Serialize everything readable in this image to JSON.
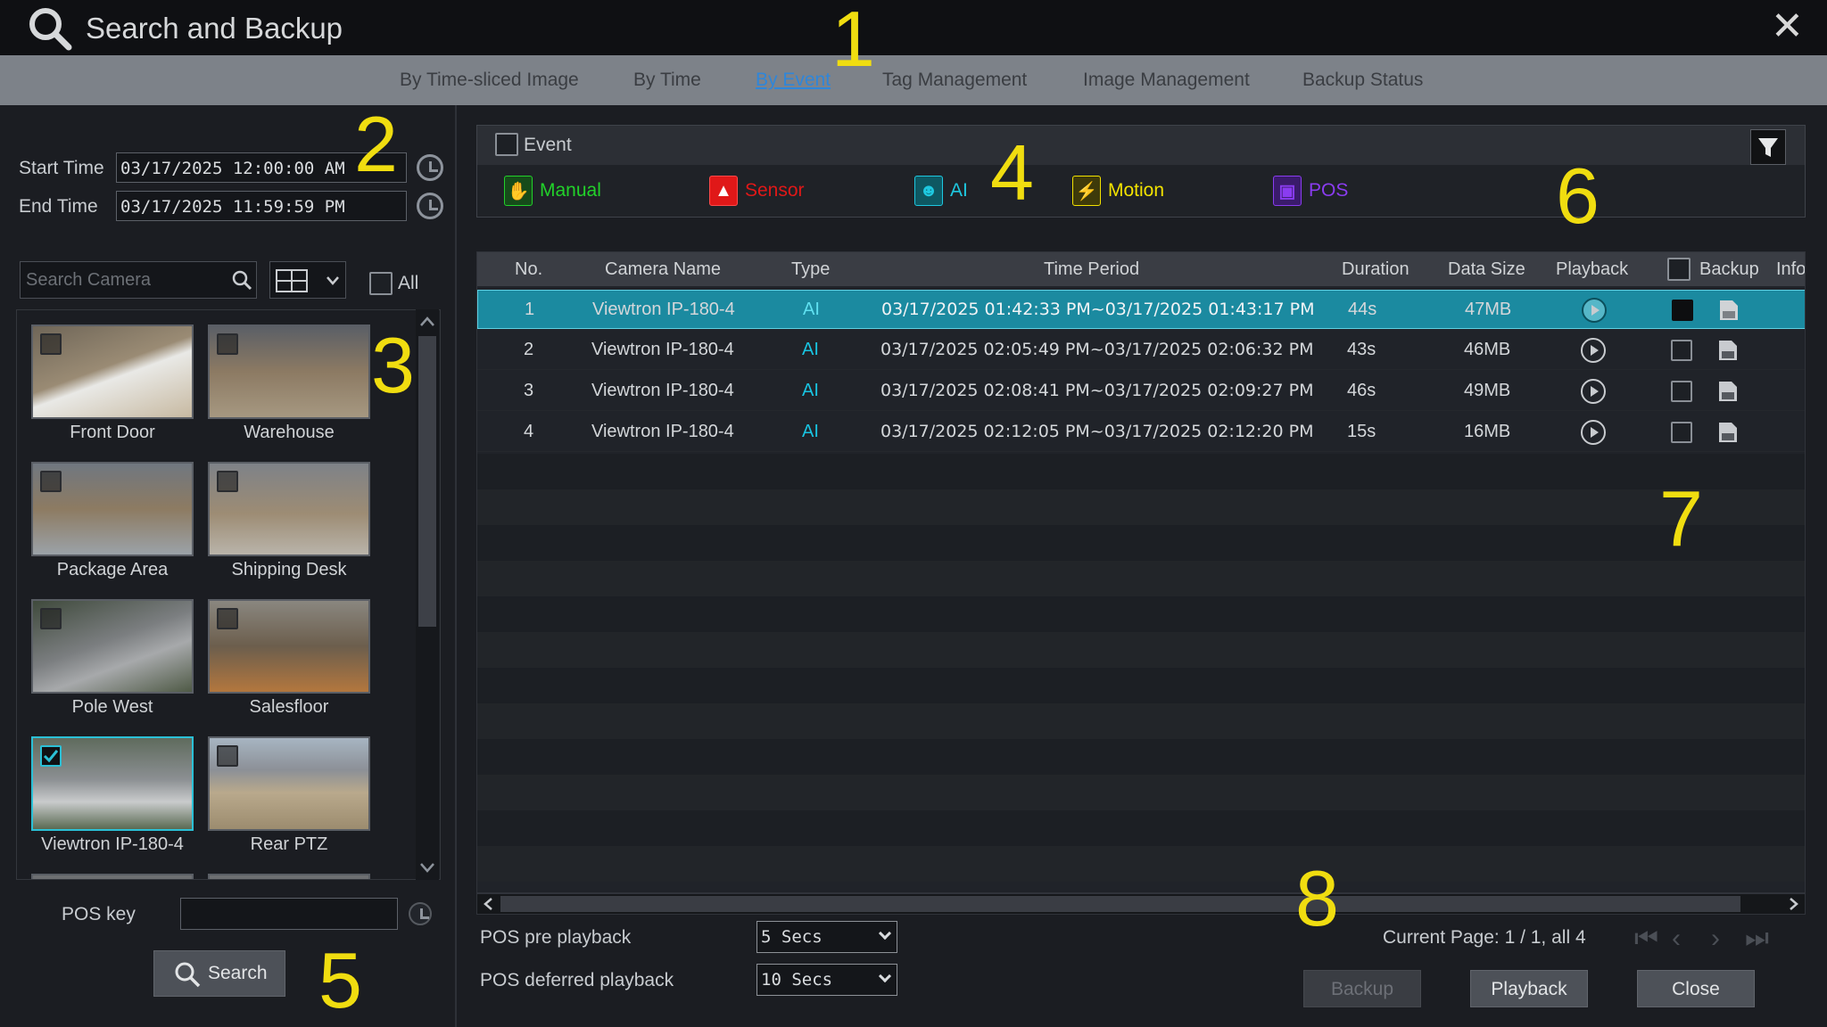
{
  "window": {
    "title": "Search and Backup",
    "close_glyph": "✕"
  },
  "tabs": [
    {
      "label": "By Time-sliced Image"
    },
    {
      "label": "By Time"
    },
    {
      "label": "By Event",
      "active": true
    },
    {
      "label": "Tag Management"
    },
    {
      "label": "Image Management"
    },
    {
      "label": "Backup Status"
    }
  ],
  "left": {
    "start_label": "Start Time",
    "start_value": "03/17/2025 12:00:00 AM",
    "end_label": "End Time",
    "end_value": "03/17/2025 11:59:59 PM",
    "search_placeholder": "Search Camera",
    "all_label": "All",
    "cameras": [
      {
        "name": "Front Door",
        "selected": false
      },
      {
        "name": "Warehouse",
        "selected": false
      },
      {
        "name": "Package Area",
        "selected": false
      },
      {
        "name": "Shipping Desk",
        "selected": false
      },
      {
        "name": "Pole West",
        "selected": false
      },
      {
        "name": "Salesfloor",
        "selected": false
      },
      {
        "name": "Viewtron IP-180-4",
        "selected": true
      },
      {
        "name": "Rear PTZ",
        "selected": false
      }
    ],
    "pos_key_label": "POS key",
    "search_button": "Search"
  },
  "events": {
    "header_label": "Event",
    "items": [
      {
        "label": "Manual",
        "color": "#22d12a"
      },
      {
        "label": "Sensor",
        "color": "#e01818"
      },
      {
        "label": "AI",
        "color": "#1ec8e0"
      },
      {
        "label": "Motion",
        "color": "#f2e200"
      },
      {
        "label": "POS",
        "color": "#8a3cf0"
      }
    ]
  },
  "table": {
    "headers": [
      "No.",
      "Camera Name",
      "Type",
      "Time Period",
      "Duration",
      "Data Size",
      "Playback",
      "Backup",
      "Info"
    ],
    "rows": [
      {
        "no": "1",
        "camera": "Viewtron IP-180-4",
        "type": "AI",
        "period": "03/17/2025 01:42:33 PM~03/17/2025 01:43:17 PM",
        "duration": "44s",
        "size": "47MB",
        "selected": true
      },
      {
        "no": "2",
        "camera": "Viewtron IP-180-4",
        "type": "AI",
        "period": "03/17/2025 02:05:49 PM~03/17/2025 02:06:32 PM",
        "duration": "43s",
        "size": "46MB",
        "selected": false
      },
      {
        "no": "3",
        "camera": "Viewtron IP-180-4",
        "type": "AI",
        "period": "03/17/2025 02:08:41 PM~03/17/2025 02:09:27 PM",
        "duration": "46s",
        "size": "49MB",
        "selected": false
      },
      {
        "no": "4",
        "camera": "Viewtron IP-180-4",
        "type": "AI",
        "period": "03/17/2025 02:12:05 PM~03/17/2025 02:12:20 PM",
        "duration": "15s",
        "size": "16MB",
        "selected": false
      }
    ]
  },
  "bottom": {
    "pos_pre_label": "POS pre playback",
    "pos_pre_value": "5 Secs",
    "pos_def_label": "POS deferred playback",
    "pos_def_value": "10 Secs",
    "page_info": "Current Page: 1 / 1, all 4",
    "backup_button": "Backup",
    "playback_button": "Playback",
    "close_button": "Close"
  },
  "callouts": [
    "1",
    "2",
    "3",
    "4",
    "5",
    "6",
    "7",
    "8"
  ]
}
